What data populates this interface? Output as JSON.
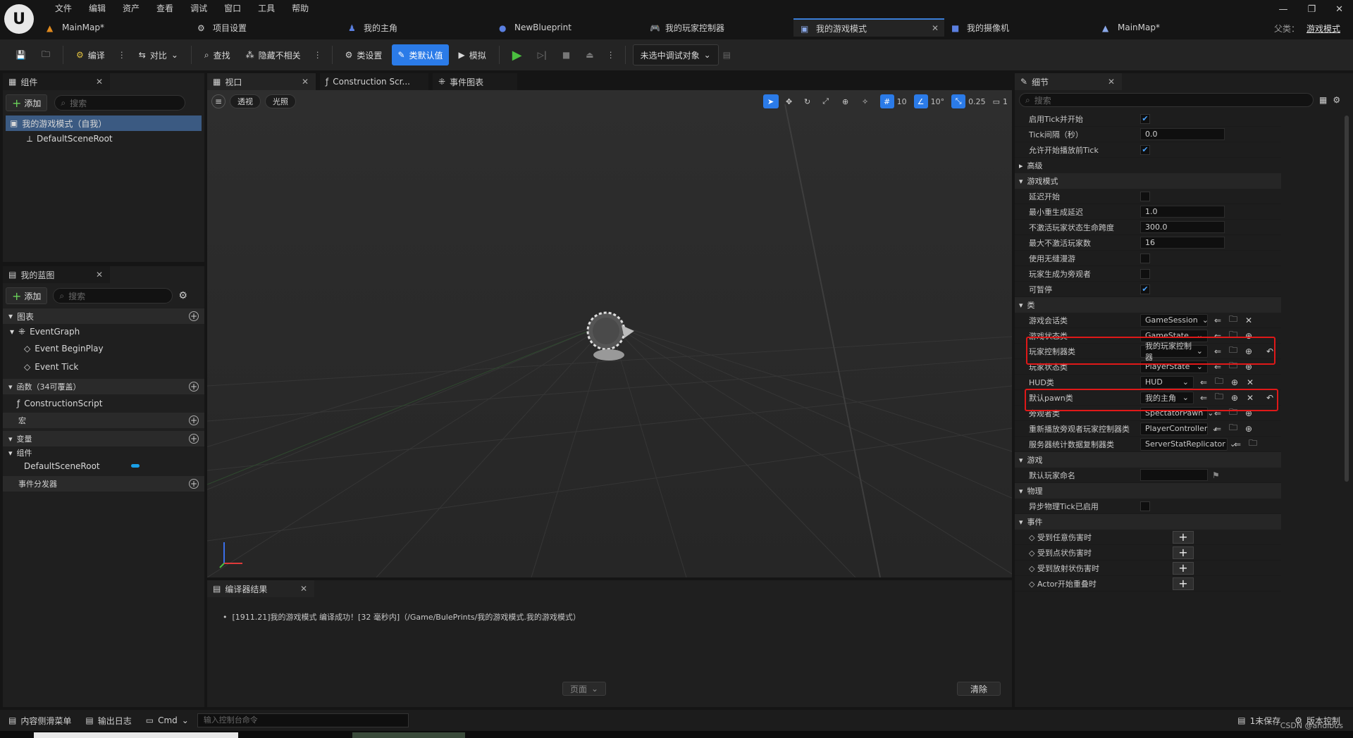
{
  "menu": [
    "文件",
    "编辑",
    "资产",
    "查看",
    "调试",
    "窗口",
    "工具",
    "帮助"
  ],
  "tabs": [
    {
      "label": "MainMap*"
    },
    {
      "label": "项目设置"
    },
    {
      "label": "我的主角"
    },
    {
      "label": "NewBlueprint"
    },
    {
      "label": "我的玩家控制器"
    },
    {
      "label": "我的游戏模式"
    },
    {
      "label": "我的摄像机"
    },
    {
      "label": "MainMap*"
    }
  ],
  "parent": {
    "label": "父类：",
    "value": "游戏模式"
  },
  "toolbar": {
    "compile": "编译",
    "diff": "对比",
    "find": "查找",
    "hide_unrelated": "隐藏不相关",
    "class_settings": "类设置",
    "class_defaults": "类默认值",
    "simulate": "模拟",
    "debug_target": "未选中调试对象"
  },
  "components": {
    "tab": "组件",
    "add": "添加",
    "search": "搜索",
    "root": "我的游戏模式（自我）",
    "child": "DefaultSceneRoot"
  },
  "mybp": {
    "tab": "我的蓝图",
    "add": "添加",
    "search": "搜索",
    "graphs": "图表",
    "eventgraph": "EventGraph",
    "ev1": "Event BeginPlay",
    "ev2": "Event Tick",
    "functions": "函数（34可覆盖）",
    "cs": "ConstructionScript",
    "macros": "宏",
    "variables": "变量",
    "comp_group": "组件",
    "comp_item": "DefaultSceneRoot",
    "dispatchers": "事件分发器"
  },
  "viewport_tabs": {
    "viewport": "视口",
    "construction": "Construction Scr...",
    "eventgraph": "事件图表"
  },
  "viewport": {
    "perspective": "透视",
    "lit": "光照",
    "grid": "10",
    "angle": "10°",
    "scale": "0.25",
    "cam": "1"
  },
  "compiler": {
    "tab": "编译器结果",
    "message": "[1911.21]我的游戏模式 编译成功！[32 毫秒内]（/Game/BulePrints/我的游戏模式.我的游戏模式）",
    "page": "页面",
    "clear": "清除"
  },
  "details": {
    "tab": "细节",
    "search": "搜索",
    "rows": {
      "tick_start": "启用Tick并开始",
      "tick_interval": "Tick间隔（秒）",
      "tick_interval_v": "0.0",
      "tick_before_play": "允许开始播放前Tick",
      "advanced": "高级",
      "gamemode": "游戏模式",
      "delay_start": "延迟开始",
      "min_respawn": "最小重生成延迟",
      "min_respawn_v": "1.0",
      "inactive_life": "不激活玩家状态生命跨度",
      "inactive_life_v": "300.0",
      "max_inactive": "最大不激活玩家数",
      "max_inactive_v": "16",
      "seamless": "使用无缝漫游",
      "spawn_spectator": "玩家生成为旁观者",
      "pausable": "可暂停",
      "classes": "类",
      "game_session": "游戏会话类",
      "game_session_v": "GameSession",
      "game_state": "游戏状态类",
      "game_state_v": "GameState",
      "pc": "玩家控制器类",
      "pc_v": "我的玩家控制器",
      "player_state": "玩家状态类",
      "player_state_v": "PlayerState",
      "hud": "HUD类",
      "hud_v": "HUD",
      "pawn": "默认pawn类",
      "pawn_v": "我的主角",
      "spectator": "旁观者类",
      "spectator_v": "SpectatorPawn",
      "replay_pc": "重新播放旁观者玩家控制器类",
      "replay_pc_v": "PlayerController",
      "stat_rep": "服务器统计数据复制器类",
      "stat_rep_v": "ServerStatReplicator",
      "game": "游戏",
      "default_name": "默认玩家命名",
      "physics": "物理",
      "async_tick": "异步物理Tick已启用",
      "events": "事件",
      "ev_any": "受到任意伤害时",
      "ev_point": "受到点状伤害时",
      "ev_radial": "受到放射状伤害时",
      "ev_overlap": "Actor开始重叠时"
    }
  },
  "status": {
    "content": "内容侧滑菜单",
    "output": "输出日志",
    "cmd": "Cmd",
    "console_ph": "输入控制台命令",
    "unsaved": "1未保存",
    "source": "版本控制",
    "watermark": "CSDN @andibus"
  }
}
